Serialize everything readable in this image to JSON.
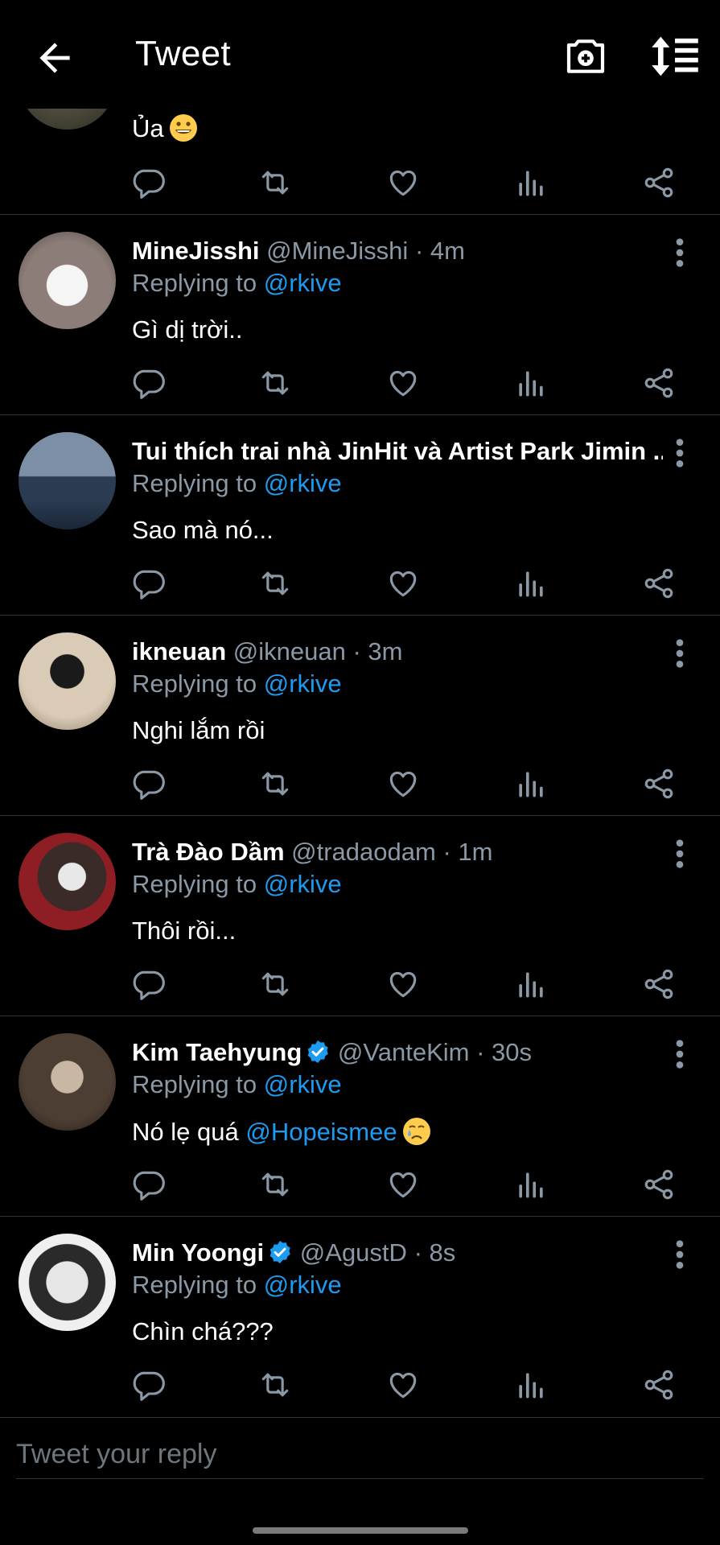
{
  "header": {
    "title": "Tweet",
    "back_icon": "arrow-left-icon",
    "camera_icon": "camera-plus-icon",
    "sort_icon": "sort-icon"
  },
  "top_tweet": {
    "body": "Ủa",
    "emoji": "grinning-face"
  },
  "tweets": [
    {
      "name": "MineJisshi",
      "handle": "@MineJisshi",
      "time": "· 4m",
      "replying_prefix": "Replying to",
      "replying_to": "@rkive",
      "body": "Gì dị trời..",
      "verified": false
    },
    {
      "name": "Tui thích trai nhà JinHit và Artist Park Jimin ...",
      "handle": "",
      "time": "",
      "replying_prefix": "Replying to",
      "replying_to": "@rkive",
      "body": "Sao mà nó...",
      "verified": false
    },
    {
      "name": "ikneuan",
      "handle": "@ikneuan",
      "time": "· 3m",
      "replying_prefix": "Replying to",
      "replying_to": "@rkive",
      "body": "Nghi lắm rồi",
      "verified": false
    },
    {
      "name": "Trà Đào Dầm",
      "handle": "@tradaodam",
      "time": "· 1m",
      "replying_prefix": "Replying to",
      "replying_to": "@rkive",
      "body": "Thôi rồi...",
      "verified": false
    },
    {
      "name": "Kim Taehyung",
      "handle": "@VanteKim",
      "time": "· 30s",
      "replying_prefix": "Replying to",
      "replying_to": "@rkive",
      "body": "Nó lẹ quá",
      "mention": "@Hopeismee",
      "emoji": "crying-face",
      "verified": true
    },
    {
      "name": "Min Yoongi",
      "handle": "@AgustD",
      "time": "· 8s",
      "replying_prefix": "Replying to",
      "replying_to": "@rkive",
      "body": "Chìn chá???",
      "verified": true
    }
  ],
  "reply_box": {
    "placeholder": "Tweet your reply"
  },
  "colors": {
    "background": "#000000",
    "accent": "#1d9bf0",
    "muted": "#8b98a5",
    "divider": "#2f3336"
  }
}
